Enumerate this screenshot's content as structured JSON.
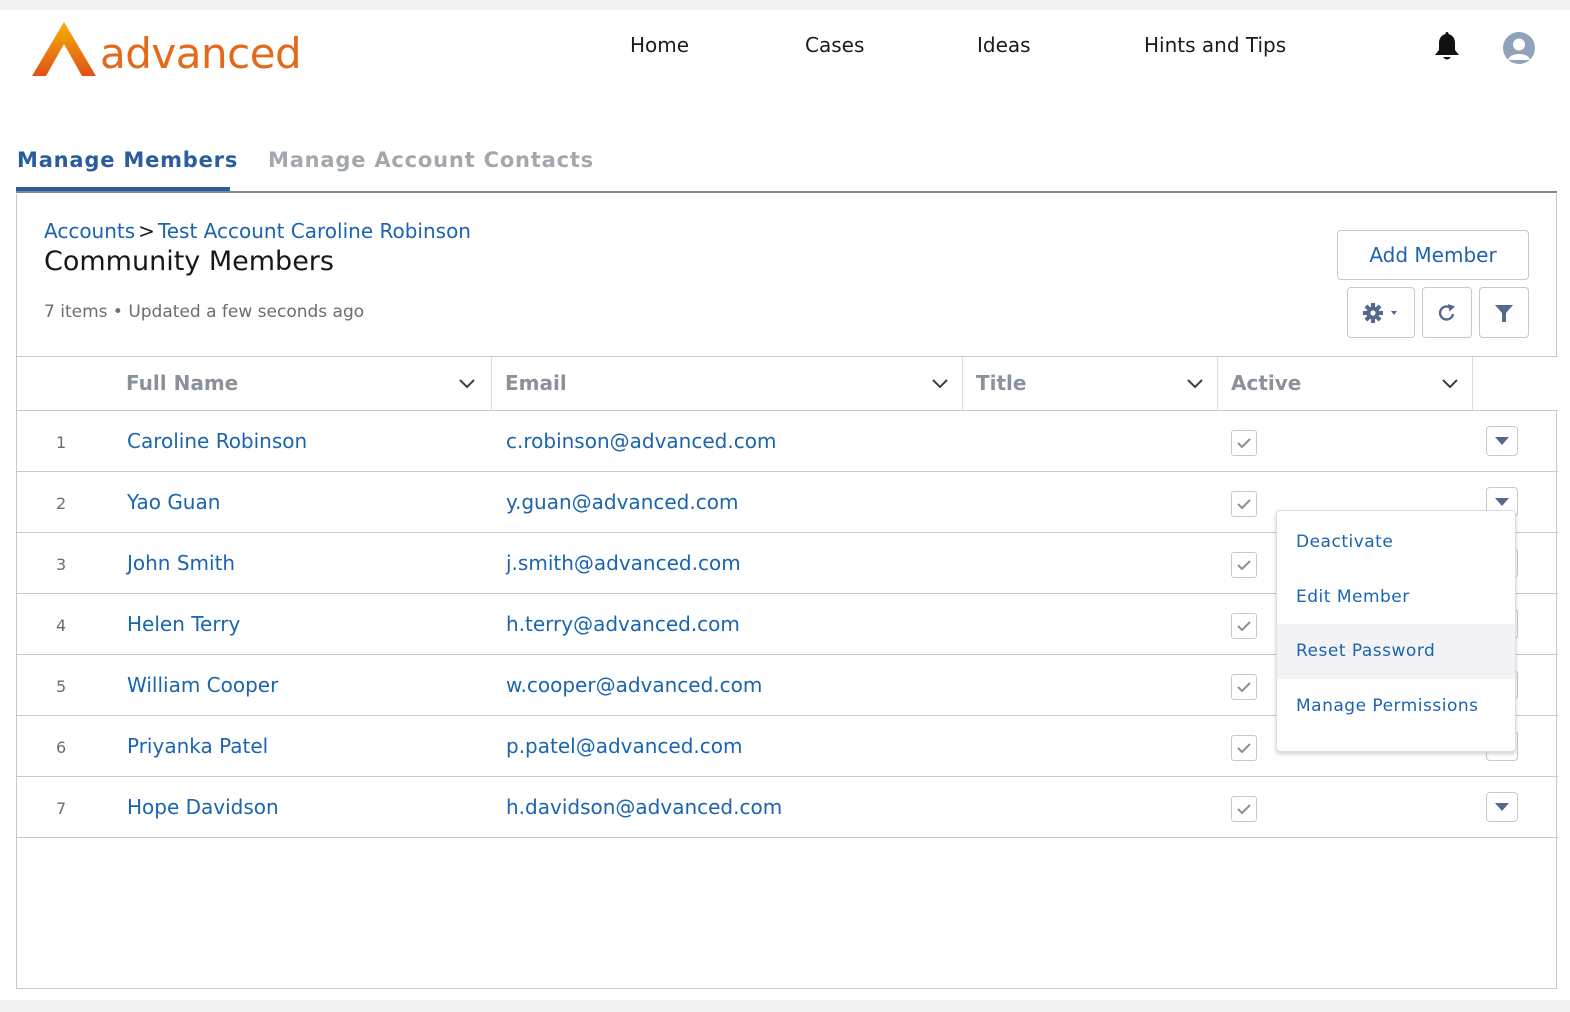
{
  "brand": {
    "name": "advanced",
    "color": "#e36a1b",
    "accent": "#f5a000"
  },
  "nav": {
    "items": [
      {
        "label": "Home"
      },
      {
        "label": "Cases"
      },
      {
        "label": "Ideas"
      },
      {
        "label": "Hints and Tips"
      }
    ],
    "notifications_icon": "bell-icon",
    "profile_icon": "user-avatar-icon"
  },
  "tabs": [
    {
      "label": "Manage Members",
      "active": true
    },
    {
      "label": "Manage Account Contacts",
      "active": false
    }
  ],
  "card": {
    "breadcrumb": {
      "root": "Accounts",
      "separator": ">",
      "current": "Test Account Caroline Robinson"
    },
    "title": "Community Members",
    "meta": "7 items • Updated a few seconds ago",
    "add_button": "Add Member",
    "toolbar_icons": [
      "gear-icon",
      "refresh-icon",
      "filter-icon"
    ]
  },
  "table": {
    "columns": [
      "Full Name",
      "Email",
      "Title",
      "Active"
    ],
    "rows": [
      {
        "num": "1",
        "name": "Caroline Robinson",
        "email": "c.robinson@advanced.com",
        "title": "",
        "active": true
      },
      {
        "num": "2",
        "name": "Yao Guan",
        "email": "y.guan@advanced.com",
        "title": "",
        "active": true
      },
      {
        "num": "3",
        "name": "John Smith",
        "email": "j.smith@advanced.com",
        "title": "",
        "active": true
      },
      {
        "num": "4",
        "name": "Helen Terry",
        "email": "h.terry@advanced.com",
        "title": "",
        "active": true
      },
      {
        "num": "5",
        "name": "William Cooper",
        "email": "w.cooper@advanced.com",
        "title": "",
        "active": true
      },
      {
        "num": "6",
        "name": "Priyanka Patel",
        "email": "p.patel@advanced.com",
        "title": "",
        "active": true
      },
      {
        "num": "7",
        "name": "Hope Davidson",
        "email": "h.davidson@advanced.com",
        "title": "",
        "active": true
      }
    ]
  },
  "row_menu": {
    "open_for_row": "2",
    "items": [
      {
        "label": "Deactivate"
      },
      {
        "label": "Edit Member"
      },
      {
        "label": "Reset Password",
        "hovered": true
      },
      {
        "label": "Manage Permissions"
      }
    ]
  }
}
